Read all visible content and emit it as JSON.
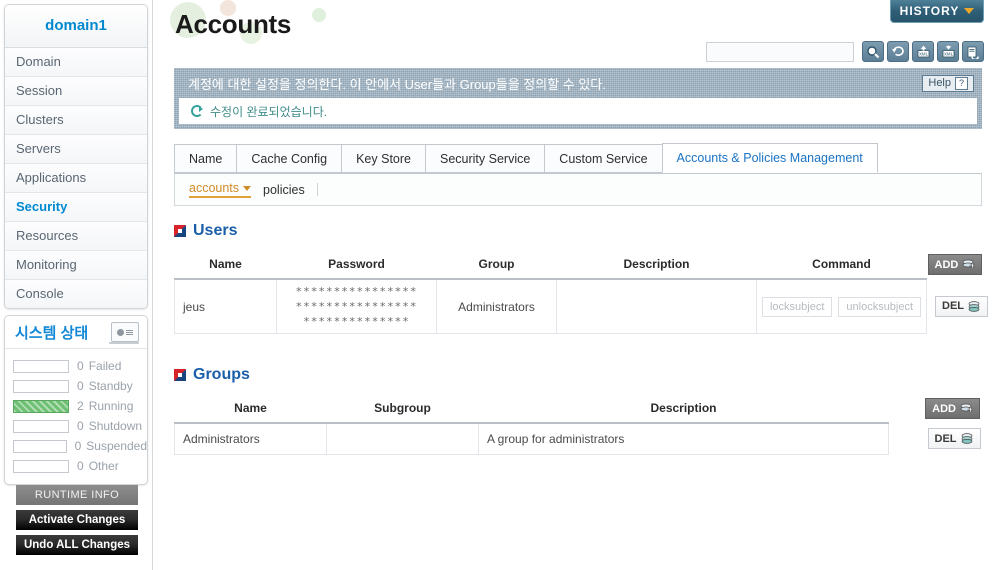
{
  "sidebar": {
    "domain_title": "domain1",
    "nav_items": [
      {
        "label": "Domain",
        "active": false
      },
      {
        "label": "Session",
        "active": false
      },
      {
        "label": "Clusters",
        "active": false
      },
      {
        "label": "Servers",
        "active": false
      },
      {
        "label": "Applications",
        "active": false
      },
      {
        "label": "Security",
        "active": true
      },
      {
        "label": "Resources",
        "active": false
      },
      {
        "label": "Monitoring",
        "active": false
      },
      {
        "label": "Console",
        "active": false
      }
    ],
    "status": {
      "title": "시스템 상태",
      "icon": "laptop-chart-icon",
      "rows": [
        {
          "count": "0",
          "label": "Failed",
          "filled": false
        },
        {
          "count": "0",
          "label": "Standby",
          "filled": false
        },
        {
          "count": "2",
          "label": "Running",
          "filled": true
        },
        {
          "count": "0",
          "label": "Shutdown",
          "filled": false
        },
        {
          "count": "0",
          "label": "Suspended",
          "filled": false
        },
        {
          "count": "0",
          "label": "Other",
          "filled": false
        }
      ],
      "fill_color": "#6ec072"
    },
    "buttons": [
      {
        "label": "RUNTIME INFO",
        "style": "gray"
      },
      {
        "label": "Activate Changes",
        "style": "black"
      },
      {
        "label": "Undo ALL Changes",
        "style": "black"
      }
    ]
  },
  "header": {
    "page_title": "Accounts",
    "history_label": "HISTORY",
    "history_caret_color": "#f0a828"
  },
  "toolbar": {
    "search_value": "",
    "search_placeholder": "",
    "icons": [
      {
        "name": "search-icon"
      },
      {
        "name": "refresh-icon"
      },
      {
        "name": "xml-import-icon"
      },
      {
        "name": "xml-export-icon"
      },
      {
        "name": "database-sync-icon"
      }
    ]
  },
  "banner": {
    "description": "계정에 대한 설정을 정의한다. 이 안에서 User들과 Group들을 정의할 수 있다.",
    "help_label": "Help",
    "message": "수정이 완료되었습니다.",
    "message_color": "#3f8d8a"
  },
  "tabs": [
    {
      "label": "Name",
      "active": false
    },
    {
      "label": "Cache Config",
      "active": false
    },
    {
      "label": "Key Store",
      "active": false
    },
    {
      "label": "Security Service",
      "active": false
    },
    {
      "label": "Custom Service",
      "active": false
    },
    {
      "label": "Accounts & Policies Management",
      "active": true
    }
  ],
  "subnav": [
    {
      "label": "accounts",
      "active": true
    },
    {
      "label": "policies",
      "active": false
    }
  ],
  "users": {
    "section_title": "Users",
    "columns": [
      "Name",
      "Password",
      "Group",
      "Description",
      "Command"
    ],
    "add_label": "ADD",
    "rows": [
      {
        "name": "jeus",
        "password": "****************************************** ********",
        "password_line1": "****************",
        "password_line2": "****************",
        "password_line3": "**************",
        "group": "Administrators",
        "description": "",
        "commands": [
          "locksubject",
          "unlocksubject"
        ],
        "delete_label": "DEL"
      }
    ]
  },
  "groups": {
    "section_title": "Groups",
    "columns": [
      "Name",
      "Subgroup",
      "Description"
    ],
    "add_label": "ADD",
    "rows": [
      {
        "name": "Administrators",
        "subgroup": "",
        "description": "A group for administrators",
        "delete_label": "DEL"
      }
    ]
  }
}
